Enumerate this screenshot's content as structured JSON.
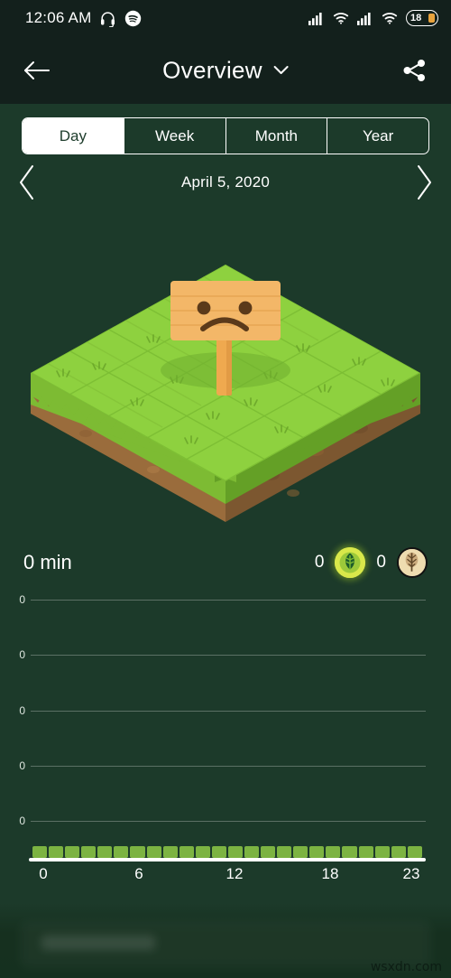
{
  "statusbar": {
    "time": "12:06 AM",
    "left_icons": [
      "headphones-icon",
      "spotify-icon"
    ],
    "right_icons": [
      "signal-bars-icon",
      "wifi-icon",
      "signal-bars-icon",
      "wifi-icon"
    ],
    "battery_level": "18"
  },
  "header": {
    "back_icon": "back-arrow-icon",
    "title": "Overview",
    "dropdown_icon": "chevron-down-icon",
    "share_icon": "share-icon"
  },
  "segmented": {
    "items": [
      {
        "label": "Day",
        "selected": true
      },
      {
        "label": "Week",
        "selected": false
      },
      {
        "label": "Month",
        "selected": false
      },
      {
        "label": "Year",
        "selected": false
      }
    ]
  },
  "datenav": {
    "prev_icon": "chevron-left-icon",
    "label": "April 5, 2020",
    "next_icon": "chevron-right-icon"
  },
  "plot": {
    "sign_expression": "sad-face",
    "tiles": "5x5",
    "alt": "isometric empty grass plot with sad wooden sign"
  },
  "summary": {
    "focus_time": "0 min",
    "leaf_count": "0",
    "leaf_icon": "leaf-badge-icon",
    "tree_count": "0",
    "tree_icon": "dead-tree-badge-icon"
  },
  "colors": {
    "background": "#1c3a2a",
    "header_bar": "#13201c",
    "accent_white": "#ffffff",
    "grass": "#8ed13f",
    "dirt": "#9a6c3c",
    "sign_wood": "#f0b15e",
    "leaf_badge": "#d9e84a",
    "tree_badge": "#eedcb0",
    "battery_fill": "#e8a33d",
    "tick_green": "#7cb342"
  },
  "chart_data": {
    "type": "bar",
    "title": "",
    "xlabel": "",
    "ylabel": "",
    "categories": [
      "0",
      "1",
      "2",
      "3",
      "4",
      "5",
      "6",
      "7",
      "8",
      "9",
      "10",
      "11",
      "12",
      "13",
      "14",
      "15",
      "16",
      "17",
      "18",
      "19",
      "20",
      "21",
      "22",
      "23"
    ],
    "values": [
      0,
      0,
      0,
      0,
      0,
      0,
      0,
      0,
      0,
      0,
      0,
      0,
      0,
      0,
      0,
      0,
      0,
      0,
      0,
      0,
      0,
      0,
      0,
      0
    ],
    "x_tick_labels": [
      "0",
      "6",
      "12",
      "18",
      "23"
    ],
    "x_tick_positions": [
      0,
      6,
      12,
      18,
      23
    ],
    "y_tick_labels": [
      "0",
      "0",
      "0",
      "0",
      "0"
    ],
    "ylim": [
      0,
      0
    ],
    "xlim": [
      0,
      23
    ],
    "grid": true,
    "legend": "none"
  },
  "bottom": {
    "watermark": "wsxdn.com"
  }
}
